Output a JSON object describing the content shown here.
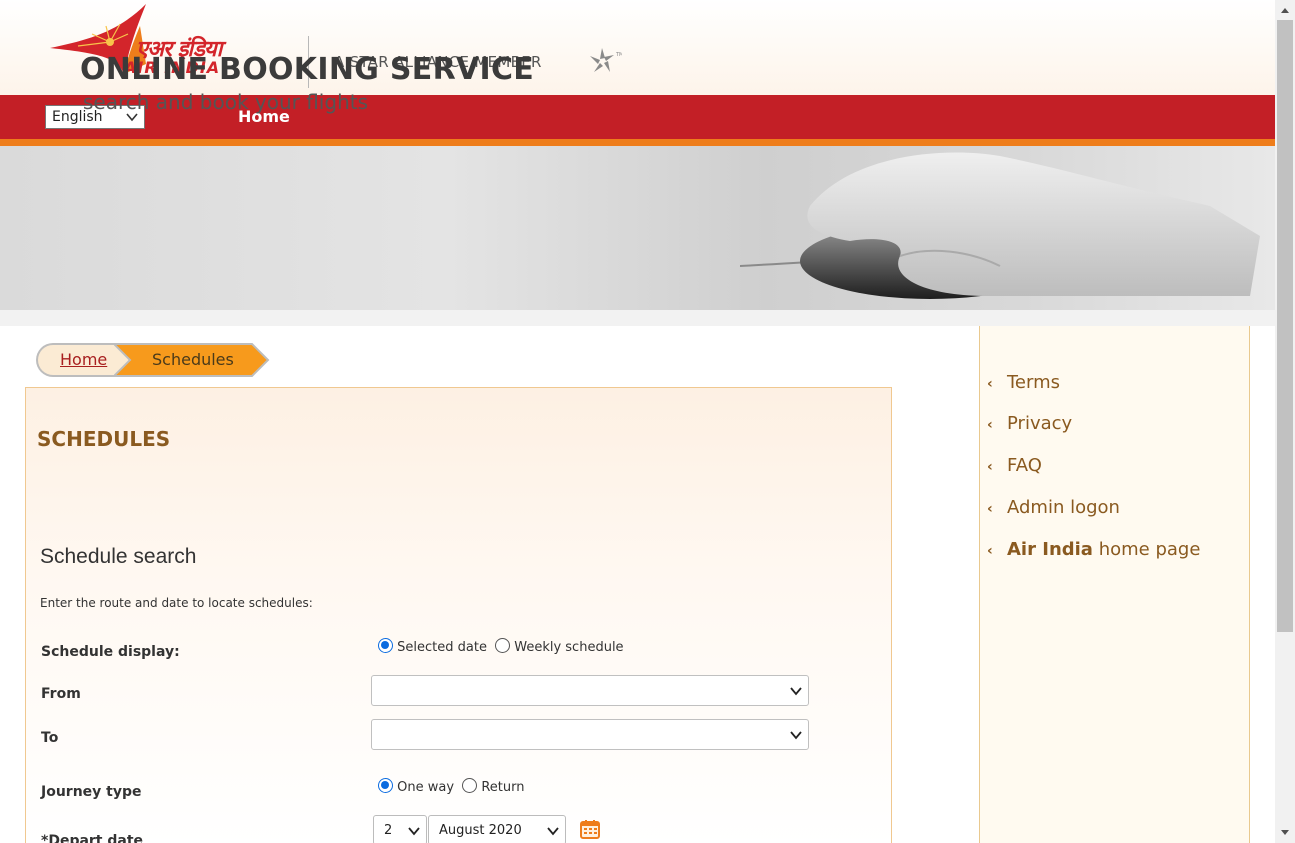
{
  "header": {
    "logo_hindi": "एअर इंडिया",
    "logo_text": "AIR INDIA",
    "alliance_text": "A STAR ALLIANCE MEMBER",
    "brand_red": "#c31f26",
    "brand_orange": "#ee7d1b"
  },
  "nav": {
    "language_selected": "English",
    "home_label": "Home"
  },
  "banner": {
    "title": "ONLINE BOOKING SERVICE",
    "subtitle": "search and book your flights"
  },
  "breadcrumb": {
    "home": "Home",
    "current": "Schedules"
  },
  "main": {
    "page_title": "SCHEDULES",
    "section_title": "Schedule search",
    "hint": "Enter the route and date to locate schedules:",
    "schedule_display": {
      "label": "Schedule display:",
      "options": [
        "Selected date",
        "Weekly schedule"
      ],
      "selected": "Selected date"
    },
    "from": {
      "label": "From",
      "value": ""
    },
    "to": {
      "label": "To",
      "value": ""
    },
    "journey_type": {
      "label": "Journey type",
      "options": [
        "One way",
        "Return"
      ],
      "selected": "One way"
    },
    "depart_date": {
      "label": "*Depart date",
      "day": "2",
      "month": "August 2020"
    }
  },
  "sidebar": {
    "items": [
      {
        "label": "Terms"
      },
      {
        "label": "Privacy"
      },
      {
        "label": "FAQ"
      },
      {
        "label": "Admin logon"
      },
      {
        "label_bold": "Air India",
        "label": "home page"
      }
    ]
  }
}
